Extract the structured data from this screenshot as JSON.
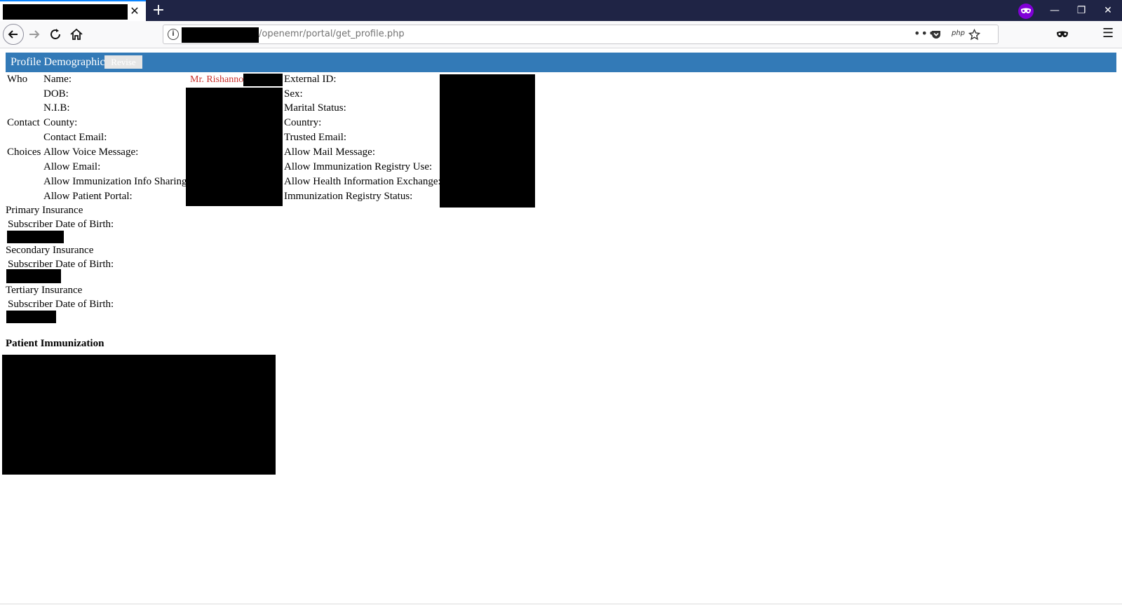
{
  "browser": {
    "tab_close_glyph": "✕",
    "new_tab_glyph": "+",
    "url_path": "/openemr/portal/get_profile.php",
    "url_info_glyph": "i",
    "more_glyph": "•••",
    "php_label": "php",
    "window_controls": {
      "minimize": "—",
      "restore": "❐",
      "close": "✕"
    },
    "menu_glyph": "☰",
    "icons": [
      "back-arrow-icon",
      "forward-arrow-icon",
      "reload-icon",
      "home-icon",
      "page-info-icon",
      "pocket-icon",
      "bookmark-star-icon",
      "private-mask-icon",
      "hamburger-menu-icon"
    ],
    "accent_color": "#0a84ff",
    "private_color": "#8000d7"
  },
  "profile": {
    "header_title": "Profile Demographics",
    "revise_label": "Revise",
    "header_color": "#337ab7",
    "sections": {
      "who": "Who",
      "contact": "Contact",
      "choices": "Choices"
    },
    "fields_left": {
      "name": "Name:",
      "dob": "DOB:",
      "nib": "N.I.B:",
      "county": "County:",
      "contact_email": "Contact Email:",
      "allow_voice": "Allow Voice Message:",
      "allow_email": "Allow Email:",
      "allow_imm_sharing": "Allow Immunization Info Sharing:",
      "allow_portal": "Allow Patient Portal:"
    },
    "fields_right": {
      "external_id": "External ID:",
      "sex": "Sex:",
      "marital": "Marital Status:",
      "country": "Country:",
      "trusted_email": "Trusted Email:",
      "allow_mail": "Allow Mail Message:",
      "allow_imm_registry": "Allow Immunization Registry Use:",
      "allow_hie": "Allow Health Information Exchange:",
      "imm_registry_status": "Immunization Registry Status:"
    },
    "name_value": "Mr. Rishanno",
    "name_color": "#c9302c"
  },
  "insurance": {
    "primary": "Primary Insurance",
    "secondary": "Secondary Insurance",
    "tertiary": "Tertiary Insurance",
    "subscriber_dob_label": "Subscriber Date of Birth:"
  },
  "immunization": {
    "title": "Patient Immunization"
  }
}
